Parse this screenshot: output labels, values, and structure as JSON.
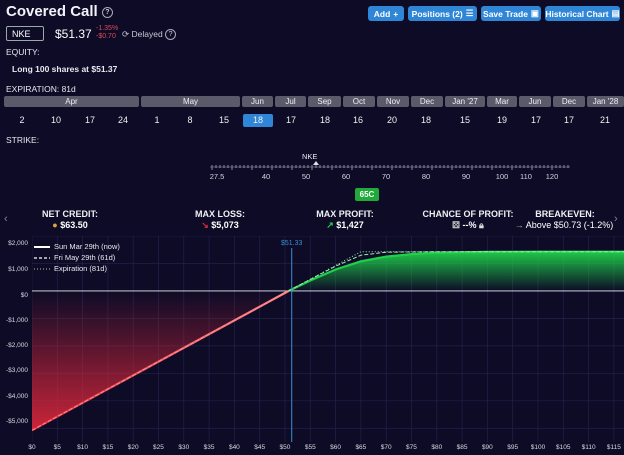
{
  "header": {
    "title": "Covered Call",
    "buttons": {
      "add": "Add",
      "positions": "Positions (2)",
      "save": "Save Trade",
      "historical": "Historical Chart"
    }
  },
  "quote": {
    "ticker": "NKE",
    "price": "$51.37",
    "change_pct": "-1.35%",
    "change_abs": "-$0.70",
    "delayed": "Delayed"
  },
  "equity": {
    "label": "EQUITY:",
    "position": "Long 100 shares at $51.37"
  },
  "expiration": {
    "label": "EXPIRATION: 81d",
    "months": [
      "Apr",
      "May",
      "Jun",
      "Jul",
      "Sep",
      "Oct",
      "Nov",
      "Dec",
      "Jan '27",
      "Mar",
      "Jun",
      "Dec",
      "Jan '28"
    ],
    "days": [
      "2",
      "10",
      "17",
      "24",
      "1",
      "8",
      "15",
      "18",
      "17",
      "18",
      "16",
      "20",
      "18",
      "15",
      "19",
      "17",
      "17",
      "21"
    ],
    "selected_day": "18"
  },
  "strike": {
    "label": "STRIKE:",
    "ticker_marker": "NKE",
    "ticks": [
      "27.5",
      "40",
      "50",
      "60",
      "70",
      "80",
      "90",
      "100",
      "110",
      "120"
    ],
    "selected": "65C"
  },
  "stats": {
    "net_credit": {
      "label": "NET CREDIT:",
      "value": "$63.50"
    },
    "max_loss": {
      "label": "MAX LOSS:",
      "value": "$5,073"
    },
    "max_profit": {
      "label": "MAX PROFIT:",
      "value": "$1,427"
    },
    "chance": {
      "label": "CHANCE OF PROFIT:",
      "value": "--%"
    },
    "breakeven": {
      "label": "BREAKEVEN:",
      "value": "Above $50.73 (-1.2%)"
    }
  },
  "chart_data": {
    "type": "line",
    "current_price_label": "$51.33",
    "current_price": 51.33,
    "xlim": [
      0,
      117
    ],
    "ylim": [
      -5500,
      2000
    ],
    "x_ticks": [
      "$0",
      "$5",
      "$10",
      "$15",
      "$20",
      "$25",
      "$30",
      "$35",
      "$40",
      "$45",
      "$50",
      "$55",
      "$60",
      "$65",
      "$70",
      "$75",
      "$80",
      "$85",
      "$90",
      "$95",
      "$100",
      "$105",
      "$110",
      "$115"
    ],
    "y_ticks": [
      "$2,000",
      "$1,000",
      "$0",
      "-$1,000",
      "-$2,000",
      "-$3,000",
      "-$4,000",
      "-$5,000"
    ],
    "series": [
      {
        "name": "Sun Mar 29th (now)",
        "x": [
          0,
          30,
          45,
          50.73,
          55,
          60,
          65,
          70,
          75,
          80,
          90,
          100,
          117
        ],
        "y": [
          -5073,
          -2073,
          -573,
          0,
          380,
          780,
          1080,
          1250,
          1340,
          1390,
          1420,
          1427,
          1427
        ]
      },
      {
        "name": "Fri May 29th (61d)",
        "x": [
          0,
          30,
          45,
          50.73,
          55,
          60,
          65,
          70,
          80,
          100,
          117
        ],
        "y": [
          -5073,
          -2073,
          -573,
          0,
          420,
          900,
          1300,
          1410,
          1427,
          1427,
          1427
        ]
      },
      {
        "name": "Expiration (81d)",
        "x": [
          0,
          30,
          45,
          50.73,
          55,
          60,
          65,
          70,
          117
        ],
        "y": [
          -5073,
          -2073,
          -573,
          0,
          427,
          927,
          1427,
          1427,
          1427
        ]
      }
    ],
    "colors": {
      "profit": "#1fd14a",
      "loss": "#e0283c",
      "price_line": "#3a8fd6"
    }
  }
}
